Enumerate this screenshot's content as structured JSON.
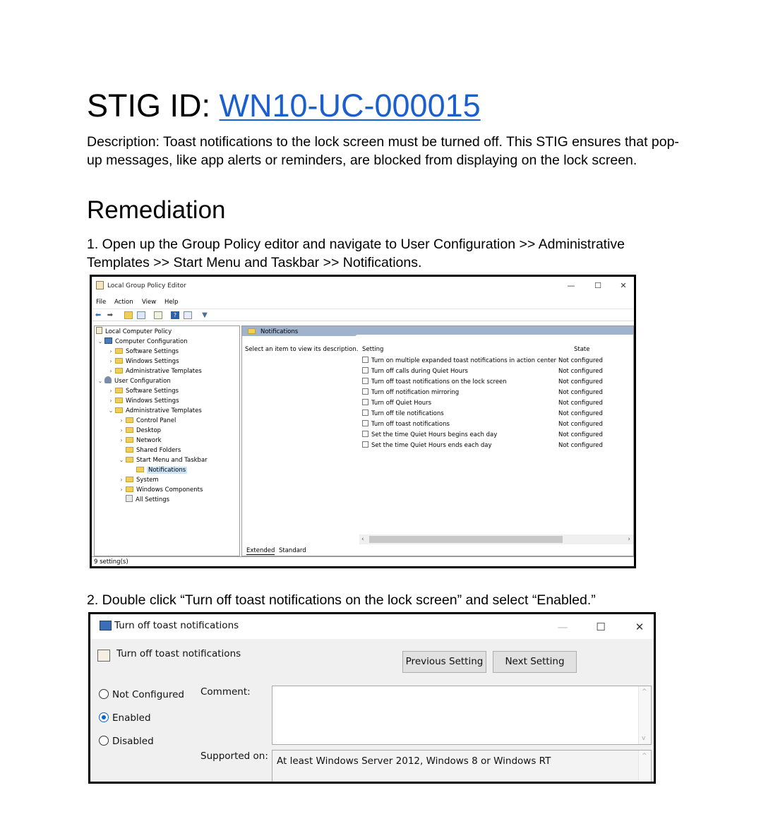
{
  "doc": {
    "title_prefix": "STIG ID: ",
    "stig_id": "WN10-UC-000015",
    "description": "Description: Toast notifications to the lock screen must be turned off. This STIG ensures that pop-up messages, like app alerts or reminders, are blocked from displaying on the lock screen.",
    "remediation_heading": "Remediation",
    "step1": "1. Open up the Group Policy editor and navigate to User Configuration >> Administrative Templates >> Start Menu and Taskbar >> Notifications.",
    "step2": "2. Double click “Turn off toast notifications on the lock screen” and select “Enabled.”"
  },
  "gpe": {
    "title": "Local Group Policy Editor",
    "minimize": "—",
    "maximize": "☐",
    "close": "✕",
    "menu": [
      "File",
      "Action",
      "View",
      "Help"
    ],
    "toolbar_icons": [
      "back-arrow-icon",
      "forward-arrow-icon",
      "up-folder-icon",
      "show-hide-tree-icon",
      "export-list-icon",
      "help-icon",
      "properties-icon",
      "filter-icon"
    ],
    "tree": [
      {
        "label": "Local Computer Policy",
        "icon": "policy-doc-icon",
        "expander": ""
      },
      {
        "label": "Computer Configuration",
        "icon": "computer-icon",
        "expander": "⌄"
      },
      {
        "label": "Software Settings",
        "icon": "folder-icon",
        "expander": "›"
      },
      {
        "label": "Windows Settings",
        "icon": "folder-icon",
        "expander": "›"
      },
      {
        "label": "Administrative Templates",
        "icon": "folder-icon",
        "expander": "›"
      },
      {
        "label": "User Configuration",
        "icon": "user-icon",
        "expander": "⌄"
      },
      {
        "label": "Software Settings",
        "icon": "folder-icon",
        "expander": "›"
      },
      {
        "label": "Windows Settings",
        "icon": "folder-icon",
        "expander": "›"
      },
      {
        "label": "Administrative Templates",
        "icon": "folder-icon",
        "expander": "⌄"
      },
      {
        "label": "Control Panel",
        "icon": "folder-icon",
        "expander": "›"
      },
      {
        "label": "Desktop",
        "icon": "folder-icon",
        "expander": "›"
      },
      {
        "label": "Network",
        "icon": "folder-icon",
        "expander": "›"
      },
      {
        "label": "Shared Folders",
        "icon": "folder-icon",
        "expander": ""
      },
      {
        "label": "Start Menu and Taskbar",
        "icon": "folder-icon",
        "expander": "⌄"
      },
      {
        "label": "Notifications",
        "icon": "folder-icon",
        "expander": "",
        "selected": true
      },
      {
        "label": "System",
        "icon": "folder-icon",
        "expander": "›"
      },
      {
        "label": "Windows Components",
        "icon": "folder-icon",
        "expander": "›"
      },
      {
        "label": "All Settings",
        "icon": "all-settings-icon",
        "expander": ""
      }
    ],
    "panel_header": "Notifications",
    "description_hint": "Select an item to view its description.",
    "col_setting": "Setting",
    "col_state": "State",
    "settings": [
      {
        "name": "Turn on multiple expanded toast notifications in action center",
        "state": "Not configured"
      },
      {
        "name": "Turn off calls during Quiet Hours",
        "state": "Not configured"
      },
      {
        "name": "Turn off toast notifications on the lock screen",
        "state": "Not configured"
      },
      {
        "name": "Turn off notification mirroring",
        "state": "Not configured"
      },
      {
        "name": "Turn off Quiet Hours",
        "state": "Not configured"
      },
      {
        "name": "Turn off tile notifications",
        "state": "Not configured"
      },
      {
        "name": "Turn off toast notifications",
        "state": "Not configured"
      },
      {
        "name": "Set the time Quiet Hours begins each day",
        "state": "Not configured"
      },
      {
        "name": "Set the time Quiet Hours ends each day",
        "state": "Not configured"
      }
    ],
    "scroll_left": "‹",
    "scroll_right": "›",
    "tab_extended": "Extended",
    "tab_standard": "Standard",
    "status": "9 setting(s)"
  },
  "dialog": {
    "title": "Turn off toast notifications",
    "policy_name": "Turn off toast notifications",
    "minimize": "—",
    "maximize": "☐",
    "close": "✕",
    "prev_button": "Previous Setting",
    "next_button": "Next Setting",
    "options": [
      {
        "label": "Not Configured",
        "selected": false
      },
      {
        "label": "Enabled",
        "selected": true
      },
      {
        "label": "Disabled",
        "selected": false
      }
    ],
    "comment_label": "Comment:",
    "comment_value": "",
    "supported_label": "Supported on:",
    "supported_value": "At least Windows Server 2012, Windows 8 or Windows RT",
    "scroll_up": "^",
    "scroll_down": "v",
    "accent_color": "#0a64c8"
  },
  "link_color": "#1a5fce"
}
